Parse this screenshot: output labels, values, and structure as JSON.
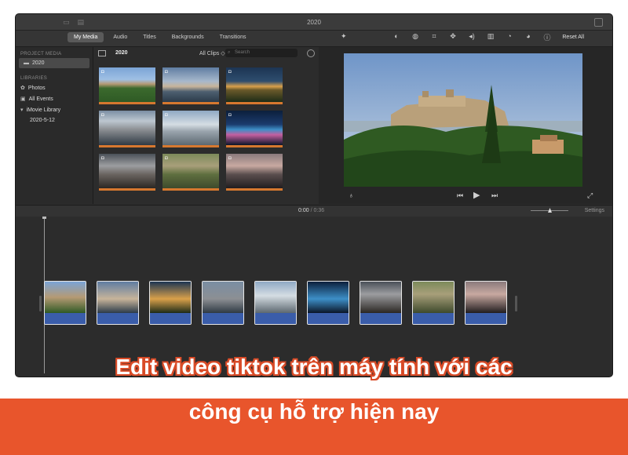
{
  "window": {
    "title": "2020"
  },
  "toolbar": {
    "tabs": [
      {
        "label": "My Media",
        "active": true
      },
      {
        "label": "Audio"
      },
      {
        "label": "Titles"
      },
      {
        "label": "Backgrounds"
      },
      {
        "label": "Transitions"
      }
    ],
    "reset_all": "Reset All"
  },
  "sidebar": {
    "project_media_header": "PROJECT MEDIA",
    "project_item": "2020",
    "libraries_header": "LIBRARIES",
    "items": [
      "Photos",
      "All Events",
      "iMovie Library",
      "2020-5-12"
    ]
  },
  "browser": {
    "event_title": "2020",
    "clips_filter": "All Clips",
    "search_placeholder": "Search"
  },
  "timeline": {
    "current_time": "0:00",
    "separator": "/",
    "total_time": "0:36",
    "settings_label": "Settings"
  },
  "caption": {
    "line1": "Edit video tiktok trên máy tính với các",
    "line2": "công cụ hỗ trợ hiện nay"
  },
  "colors": {
    "banner": "#e8552c",
    "thumb_underline": "#d6782f",
    "audio_track": "#3a5daa"
  }
}
